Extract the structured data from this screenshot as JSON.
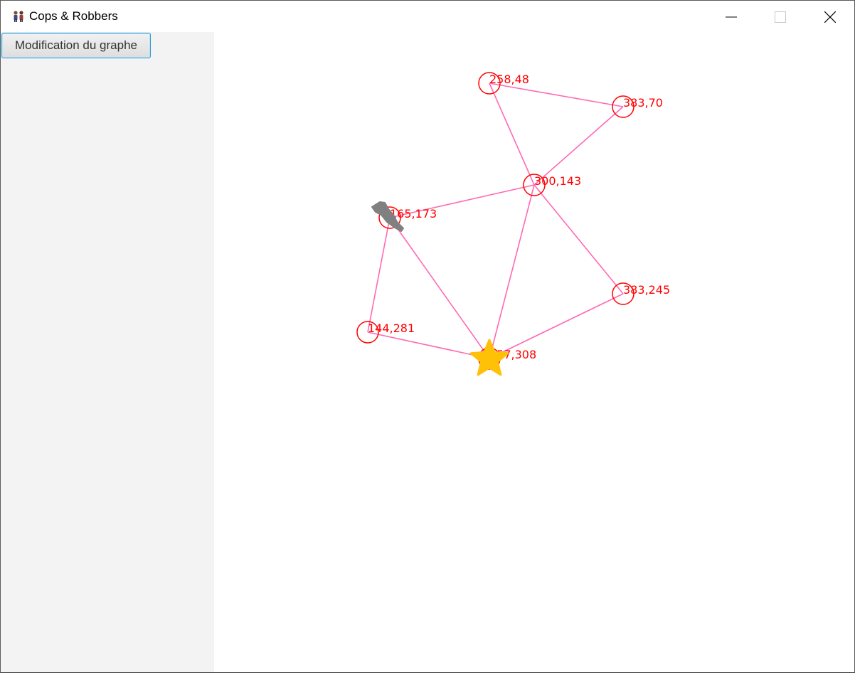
{
  "window": {
    "title": "Cops & Robbers",
    "app_icon": "people-icon",
    "controls": [
      "minimize-icon",
      "maximize-icon",
      "close-icon"
    ]
  },
  "sidebar": {
    "button_label": "Modification du graphe"
  },
  "graph": {
    "node_color": "#ff0000",
    "edge_color": "#ff69b4",
    "nodes": [
      {
        "id": "n258_48",
        "label": "258,48"
      },
      {
        "id": "n383_70",
        "label": "383,70"
      },
      {
        "id": "n300_143",
        "label": "300,143"
      },
      {
        "id": "n165_173",
        "label": "165,173"
      },
      {
        "id": "n383_245",
        "label": "383,245"
      },
      {
        "id": "n144_281",
        "label": "144,281"
      },
      {
        "id": "n257_308",
        "label": "257,308"
      }
    ],
    "edges": [
      [
        "n258_48",
        "n383_70"
      ],
      [
        "n258_48",
        "n300_143"
      ],
      [
        "n383_70",
        "n300_143"
      ],
      [
        "n300_143",
        "n165_173"
      ],
      [
        "n300_143",
        "n383_245"
      ],
      [
        "n300_143",
        "n257_308"
      ],
      [
        "n165_173",
        "n144_281"
      ],
      [
        "n165_173",
        "n257_308"
      ],
      [
        "n144_281",
        "n257_308"
      ],
      [
        "n383_245",
        "n257_308"
      ]
    ],
    "cop": {
      "node": "n257_308",
      "icon": "sheriff-star-icon",
      "color": "#ffc107"
    },
    "robber": {
      "node": "n165_173",
      "icon": "robber-icon",
      "color": "#808080"
    }
  }
}
